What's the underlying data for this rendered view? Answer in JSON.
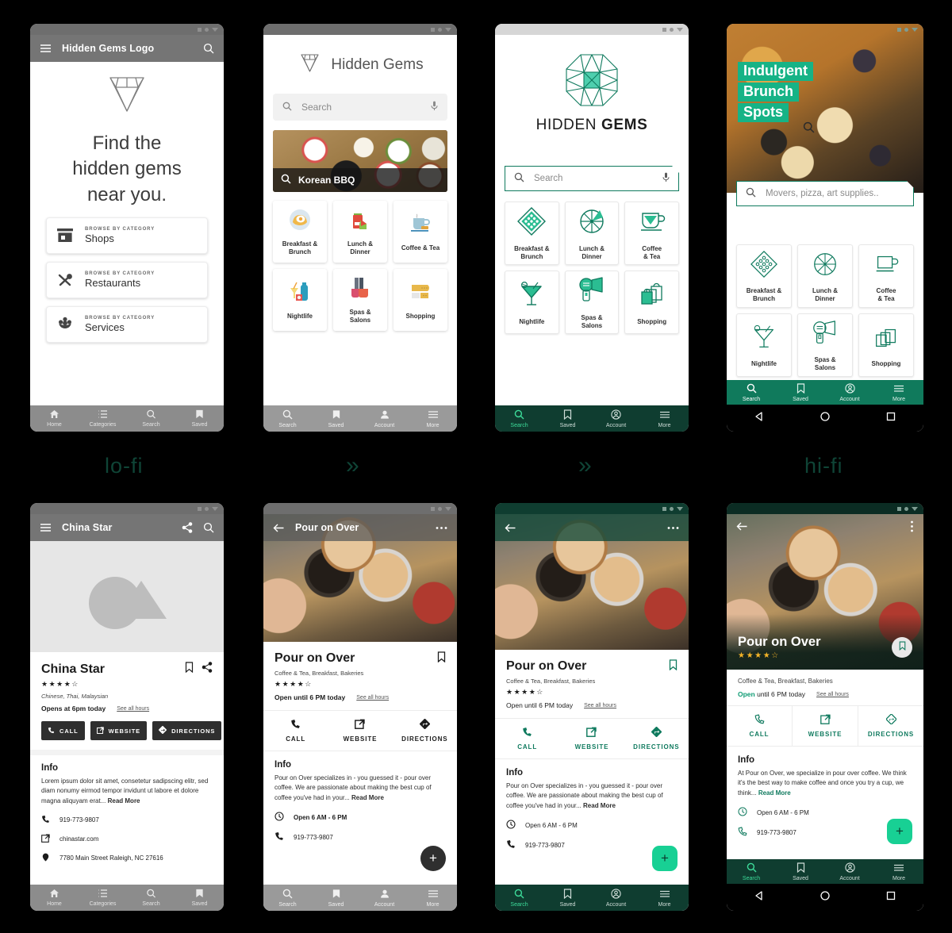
{
  "meta": {
    "accent_teal": "#0f7a5e",
    "accent_dark_teal": "#0f3d30",
    "accent_bright": "#18d094",
    "grey_chrome": "#757575"
  },
  "stage_labels": {
    "lofi": "lo-fi",
    "hifi": "hi-fi",
    "chevron": "»"
  },
  "screen1": {
    "appbar": {
      "title": "Hidden Gems Logo",
      "menu_icon": "hamburger-icon",
      "search_icon": "search-icon"
    },
    "headline": [
      "Find the",
      "hidden gems",
      "near you."
    ],
    "logo_icon": "diamond-icon",
    "categories": [
      {
        "kicker": "BROWSE BY CATEGORY",
        "label": "Shops",
        "icon": "storefront-icon"
      },
      {
        "kicker": "BROWSE BY CATEGORY",
        "label": "Restaurants",
        "icon": "fork-spoon-icon"
      },
      {
        "kicker": "BROWSE BY CATEGORY",
        "label": "Services",
        "icon": "flower-icon"
      }
    ],
    "bottom_nav": [
      {
        "label": "Home",
        "icon": "home-icon"
      },
      {
        "label": "Categories",
        "icon": "list-icon"
      },
      {
        "label": "Search",
        "icon": "search-icon"
      },
      {
        "label": "Saved",
        "icon": "bookmark-icon"
      }
    ]
  },
  "screen2": {
    "brand": "Hidden Gems",
    "logo_icon": "diamond-icon",
    "search": {
      "placeholder": "Search",
      "leading_icon": "search-icon",
      "trailing_icon": "microphone-icon"
    },
    "hero": {
      "caption": "Korean BBQ",
      "icon": "search-icon"
    },
    "tiles": [
      {
        "label": "Breakfast &\nBrunch",
        "icon": "egg-toast-icon"
      },
      {
        "label": "Lunch &\nDinner",
        "icon": "takeout-bag-icon"
      },
      {
        "label": "Coffee & Tea",
        "icon": "coffee-cup-icon"
      },
      {
        "label": "Nightlife",
        "icon": "cocktail-icon"
      },
      {
        "label": "Spas &\nSalons",
        "icon": "nail-polish-icon"
      },
      {
        "label": "Shopping",
        "icon": "belt-icon"
      }
    ],
    "bottom_nav": [
      {
        "label": "Search",
        "icon": "search-icon"
      },
      {
        "label": "Saved",
        "icon": "bookmark-icon"
      },
      {
        "label": "Account",
        "icon": "person-icon"
      },
      {
        "label": "More",
        "icon": "hamburger-icon"
      }
    ]
  },
  "screen3": {
    "wordmark_thin": "HIDDEN",
    "wordmark_bold": "GEMS",
    "logo_icon": "gem-octagon-icon",
    "search": {
      "placeholder": "Search",
      "leading_icon": "search-icon",
      "trailing_icon": "microphone-icon"
    },
    "tiles": [
      {
        "label": "Breakfast &\nBrunch",
        "icon": "waffle-diamond-icon"
      },
      {
        "label": "Lunch &\nDinner",
        "icon": "pizza-wheel-icon"
      },
      {
        "label": "Coffee\n& Tea",
        "icon": "coffee-cup-icon"
      },
      {
        "label": "Nightlife",
        "icon": "martini-icon"
      },
      {
        "label": "Spas &\nSalons",
        "icon": "hairdryer-icon"
      },
      {
        "label": "Shopping",
        "icon": "shopping-bags-icon"
      }
    ],
    "bottom_nav": [
      {
        "label": "Search",
        "icon": "search-icon",
        "active": true
      },
      {
        "label": "Saved",
        "icon": "bookmark-icon"
      },
      {
        "label": "Account",
        "icon": "person-circle-icon"
      },
      {
        "label": "More",
        "icon": "hamburger-icon"
      }
    ]
  },
  "screen4": {
    "hero_headline": [
      "Indulgent",
      "Brunch",
      "Spots"
    ],
    "hero_search_icon": "search-icon",
    "search": {
      "placeholder": "Movers, pizza, art supplies..",
      "leading_icon": "search-icon"
    },
    "tiles": [
      {
        "label": "Breakfast &\nBrunch",
        "icon": "waffle-diamond-icon"
      },
      {
        "label": "Lunch &\nDinner",
        "icon": "pizza-wheel-icon"
      },
      {
        "label": "Coffee\n& Tea",
        "icon": "coffee-cup-icon"
      },
      {
        "label": "Nightlife",
        "icon": "martini-icon"
      },
      {
        "label": "Spas &\nSalons",
        "icon": "hairdryer-icon"
      },
      {
        "label": "Shopping",
        "icon": "shopping-bags-icon"
      }
    ],
    "bottom_nav": [
      {
        "label": "Search",
        "icon": "search-icon",
        "active": true
      },
      {
        "label": "Saved",
        "icon": "bookmark-icon"
      },
      {
        "label": "Account",
        "icon": "person-circle-icon"
      },
      {
        "label": "More",
        "icon": "hamburger-icon"
      }
    ],
    "system_nav": [
      "back-triangle-icon",
      "home-circle-icon",
      "recents-square-icon"
    ]
  },
  "screen5": {
    "appbar": {
      "title": "China Star",
      "menu_icon": "hamburger-icon",
      "share_icon": "share-icon",
      "search_icon": "search-icon"
    },
    "name": "China Star",
    "stars": "★★★★☆",
    "cats": "Chinese, Thai, Malaysian",
    "hours": "Opens at 6pm today",
    "hours_link": "See all hours",
    "bookmark_icon": "bookmark-icon",
    "share_icon": "share-icon",
    "buttons": [
      {
        "label": "CALL",
        "icon": "phone-icon"
      },
      {
        "label": "WEBSITE",
        "icon": "external-link-icon"
      },
      {
        "label": "DIRECTIONS",
        "icon": "directions-icon"
      }
    ],
    "info_heading": "Info",
    "info_text": "Lorem ipsum dolor sit amet, consetetur sadipscing elitr, sed diam nonumy eirmod tempor invidunt ut labore et dolore magna aliquyam erat...",
    "info_more": "Read More",
    "rows": [
      {
        "icon": "phone-icon",
        "text": "919-773-9807"
      },
      {
        "icon": "external-link-icon",
        "text": "chinastar.com"
      },
      {
        "icon": "location-icon",
        "text": "7780 Main Street Raleigh, NC 27616"
      }
    ],
    "bottom_nav": [
      {
        "label": "Home",
        "icon": "home-icon"
      },
      {
        "label": "Categories",
        "icon": "list-icon"
      },
      {
        "label": "Search",
        "icon": "search-icon"
      },
      {
        "label": "Saved",
        "icon": "bookmark-icon"
      }
    ]
  },
  "screen6": {
    "appbar": {
      "title": "Pour on Over",
      "back_icon": "back-arrow-icon",
      "overflow_icon": "more-horizontal-icon"
    },
    "name": "Pour on Over",
    "cats": "Coffee & Tea, Breakfast, Bakeries",
    "stars": "★★★★☆",
    "hours": "Open until 6 PM today",
    "hours_link": "See all hours",
    "bookmark_icon": "bookmark-icon",
    "buttons": [
      {
        "label": "CALL",
        "icon": "phone-icon"
      },
      {
        "label": "WEBSITE",
        "icon": "external-link-icon"
      },
      {
        "label": "DIRECTIONS",
        "icon": "directions-icon"
      }
    ],
    "info_heading": "Info",
    "info_text": "Pour on Over specializes in - you guessed it - pour over coffee. We are passionate about making the best cup of coffee you've had in your...",
    "info_more": "Read More",
    "rows": [
      {
        "icon": "clock-icon",
        "text": "Open   6 AM - 6 PM"
      },
      {
        "icon": "phone-icon",
        "text": "919-773-9807"
      }
    ],
    "fab_label": "+",
    "bottom_nav": [
      {
        "label": "Search",
        "icon": "search-icon"
      },
      {
        "label": "Saved",
        "icon": "bookmark-icon"
      },
      {
        "label": "Account",
        "icon": "person-icon"
      },
      {
        "label": "More",
        "icon": "hamburger-icon"
      }
    ]
  },
  "screen7": {
    "appbar": {
      "back_icon": "back-arrow-icon",
      "overflow_icon": "more-horizontal-icon"
    },
    "name": "Pour on Over",
    "cats": "Coffee & Tea, Breakfast, Bakeries",
    "stars": "★★★★☆",
    "hours": "Open until 6 PM today",
    "hours_link": "See all hours",
    "bookmark_icon": "bookmark-icon",
    "buttons": [
      {
        "label": "CALL",
        "icon": "phone-icon"
      },
      {
        "label": "WEBSITE",
        "icon": "external-link-icon"
      },
      {
        "label": "DIRECTIONS",
        "icon": "directions-icon"
      }
    ],
    "info_heading": "Info",
    "info_text": "Pour on Over specializes in - you guessed it - pour over coffee. We are passionate about making the best cup of coffee you've had in your...",
    "info_more": "Read More",
    "rows": [
      {
        "icon": "clock-icon",
        "text": "Open   6 AM - 6 PM"
      },
      {
        "icon": "phone-icon",
        "text": "919-773-9807"
      }
    ],
    "fab_label": "+",
    "bottom_nav": [
      {
        "label": "Search",
        "icon": "search-icon",
        "active": true
      },
      {
        "label": "Saved",
        "icon": "bookmark-icon"
      },
      {
        "label": "Account",
        "icon": "person-circle-icon"
      },
      {
        "label": "More",
        "icon": "hamburger-icon"
      }
    ]
  },
  "screen8": {
    "appbar": {
      "back_icon": "back-arrow-icon",
      "overflow_icon": "more-vertical-icon"
    },
    "name": "Pour on Over",
    "stars": "★★★★☆",
    "cats": "Coffee & Tea, Breakfast, Bakeries",
    "open_word": "Open",
    "hours": " until 6 PM today",
    "hours_link": "See all hours",
    "bookmark_icon": "bookmark-icon",
    "buttons": [
      {
        "label": "CALL",
        "icon": "phone-icon"
      },
      {
        "label": "WEBSITE",
        "icon": "external-link-icon"
      },
      {
        "label": "DIRECTIONS",
        "icon": "directions-icon"
      }
    ],
    "info_heading": "Info",
    "info_text": "At Pour on Over, we specialize in pour over coffee. We think it's the best way to make coffee and once you try a cup, we think...",
    "info_more": "Read More",
    "rows": [
      {
        "icon": "clock-icon",
        "text": "Open 6 AM - 6 PM"
      },
      {
        "icon": "phone-icon",
        "text": "919-773-9807"
      }
    ],
    "fab_label": "+",
    "bottom_nav": [
      {
        "label": "Search",
        "icon": "search-icon",
        "active": true
      },
      {
        "label": "Saved",
        "icon": "bookmark-icon"
      },
      {
        "label": "Account",
        "icon": "person-circle-icon"
      },
      {
        "label": "More",
        "icon": "hamburger-icon"
      }
    ],
    "system_nav": [
      "back-triangle-icon",
      "home-circle-icon",
      "recents-square-icon"
    ]
  }
}
